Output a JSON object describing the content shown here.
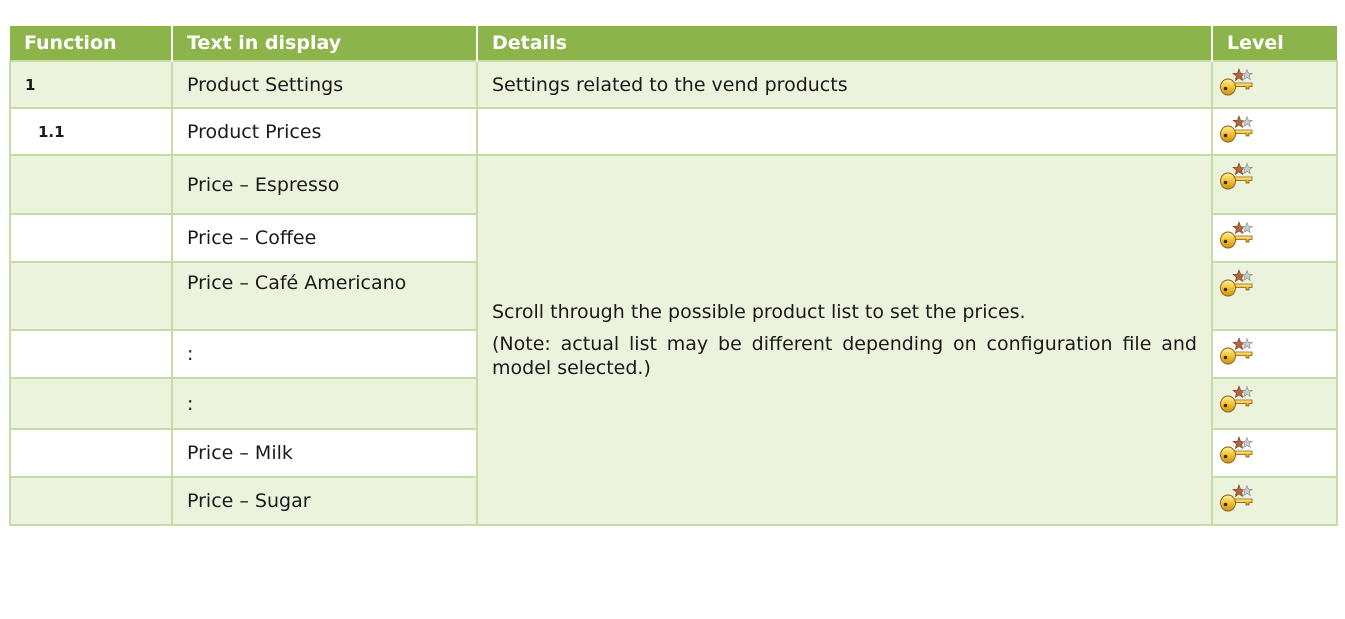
{
  "table": {
    "headers": {
      "function": "Function",
      "text_in_display": "Text in display",
      "details": "Details",
      "level": "Level"
    },
    "rows": [
      {
        "function": "1",
        "text": "Product Settings",
        "details": "Settings related to the vend products",
        "level_icon": "key-star-icon"
      },
      {
        "function": "1.1",
        "text": "Product Prices",
        "details": "",
        "level_icon": "key-star-icon"
      },
      {
        "function": "",
        "text": "Price – Espresso",
        "level_icon": "key-star-icon"
      },
      {
        "function": "",
        "text": "Price – Coffee",
        "level_icon": "key-star-icon"
      },
      {
        "function": "",
        "text": "Price – Café Americano",
        "level_icon": "key-star-icon"
      },
      {
        "function": "",
        "text": ":",
        "level_icon": "key-star-icon"
      },
      {
        "function": "",
        "text": ":",
        "level_icon": "key-star-icon"
      },
      {
        "function": "",
        "text": "Price – Milk",
        "level_icon": "key-star-icon"
      },
      {
        "function": "",
        "text": "Price – Sugar",
        "level_icon": "key-star-icon"
      }
    ],
    "merged_details": {
      "main": "Scroll through the possible product list to set the prices.",
      "note": "(Note: actual list may be different depending on configuration file and model selected.)"
    }
  },
  "colors": {
    "header_bg": "#8cb44a",
    "row_green": "#ebf3dd",
    "row_white": "#ffffff",
    "border": "#c6dca6"
  }
}
